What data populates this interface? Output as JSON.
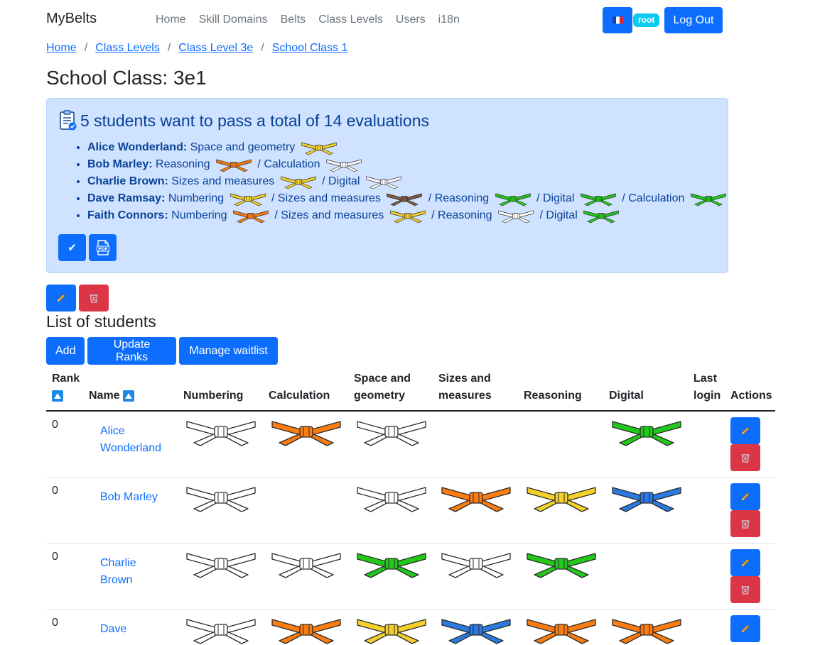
{
  "nav": {
    "brand": "MyBelts",
    "items": [
      "Home",
      "Skill Domains",
      "Belts",
      "Class Levels",
      "Users",
      "i18n"
    ],
    "user_badge": "root",
    "logout_label": "Log Out",
    "flag_icon": "france-flag-icon"
  },
  "breadcrumb": [
    "Home",
    "Class Levels",
    "Class Level 3e",
    "School Class 1"
  ],
  "page_title": "School Class: 3e1",
  "belt_colors": {
    "white": "#ffffff",
    "yellow": "#f3d02b",
    "orange": "#fb7d12",
    "green": "#22c91a",
    "blue": "#2a7ae0",
    "brown": "#7d5a44"
  },
  "summary": {
    "title": "5 students want to pass a total of 14 evaluations",
    "icon": "clipboard-check-icon",
    "students": [
      {
        "name": "Alice Wonderland:",
        "wishes": [
          {
            "domain": "Space and geometry",
            "belt": "yellow"
          }
        ]
      },
      {
        "name": "Bob Marley:",
        "wishes": [
          {
            "domain": "Reasoning",
            "belt": "orange"
          },
          {
            "domain": "Calculation",
            "belt": "white"
          }
        ]
      },
      {
        "name": "Charlie Brown:",
        "wishes": [
          {
            "domain": "Sizes and measures",
            "belt": "yellow"
          },
          {
            "domain": "Digital",
            "belt": "white"
          }
        ]
      },
      {
        "name": "Dave Ramsay:",
        "wishes": [
          {
            "domain": "Numbering",
            "belt": "yellow"
          },
          {
            "domain": "Sizes and measures",
            "belt": "brown"
          },
          {
            "domain": "Reasoning",
            "belt": "green"
          },
          {
            "domain": "Digital",
            "belt": "green"
          },
          {
            "domain": "Calculation",
            "belt": "green"
          }
        ]
      },
      {
        "name": "Faith Connors:",
        "wishes": [
          {
            "domain": "Numbering",
            "belt": "orange"
          },
          {
            "domain": "Sizes and measures",
            "belt": "yellow"
          },
          {
            "domain": "Reasoning",
            "belt": "white"
          },
          {
            "domain": "Digital",
            "belt": "green"
          }
        ]
      }
    ],
    "validate_icon": "check-icon",
    "pdf_icon": "pdf-icon",
    "pdf_label": "PDF"
  },
  "class_actions": {
    "edit_icon": "pencil-icon",
    "delete_icon": "trash-icon"
  },
  "students_section": {
    "title": "List of students",
    "add_label": "Add",
    "update_ranks_label": "Update Ranks",
    "waitlist_label": "Manage waitlist"
  },
  "table": {
    "columns": [
      "Rank",
      "Name",
      "Numbering",
      "Calculation",
      "Space and geometry",
      "Sizes and measures",
      "Reasoning",
      "Digital",
      "Last login",
      "Actions"
    ],
    "rows": [
      {
        "rank": "0",
        "name": "Alice Wonderland",
        "belts": [
          "white",
          "orange",
          "white",
          null,
          null,
          "green"
        ],
        "last_login": ""
      },
      {
        "rank": "0",
        "name": "Bob Marley",
        "belts": [
          "white",
          null,
          "white",
          "orange",
          "yellow",
          "blue"
        ],
        "last_login": ""
      },
      {
        "rank": "0",
        "name": "Charlie Brown",
        "belts": [
          "white",
          "white",
          "green",
          "white",
          "green",
          null
        ],
        "last_login": ""
      },
      {
        "rank": "0",
        "name": "Dave",
        "belts": [
          "white",
          "orange",
          "yellow",
          "blue",
          "orange",
          "orange"
        ],
        "last_login": ""
      }
    ]
  }
}
